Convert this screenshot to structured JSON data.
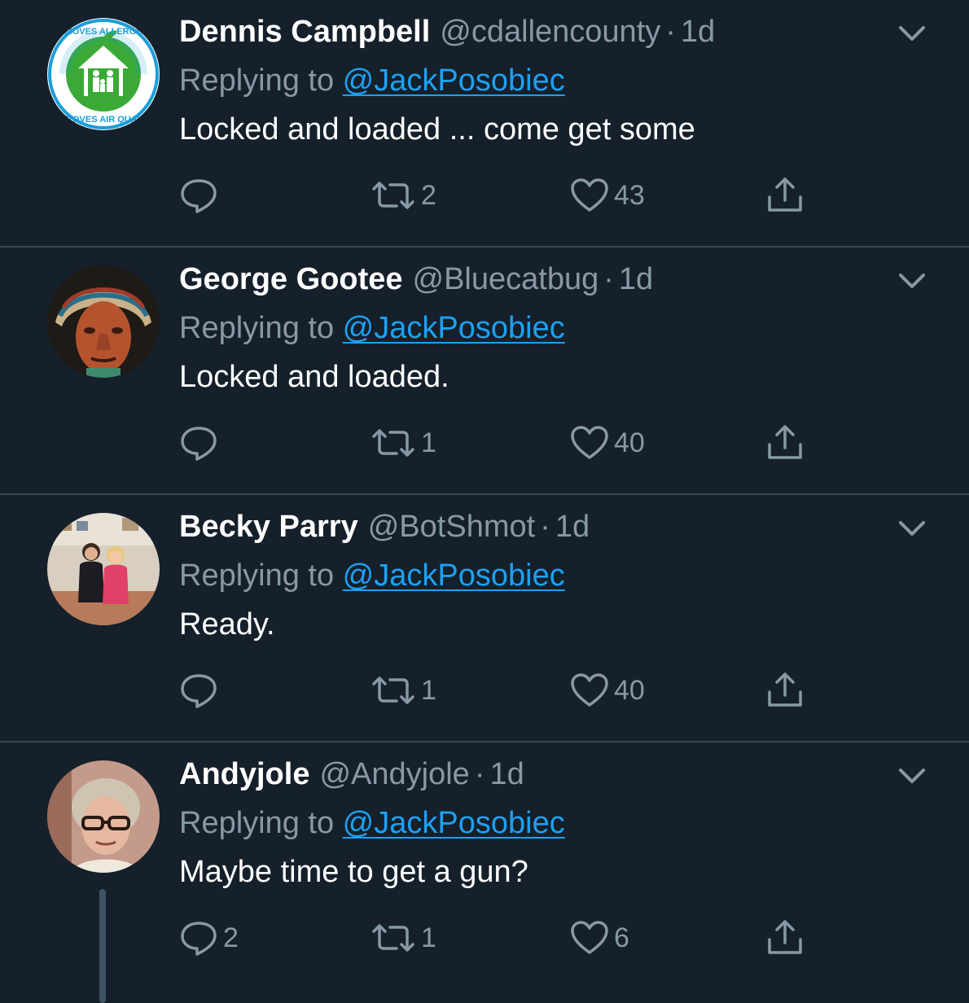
{
  "tweets": [
    {
      "name": "Dennis Campbell",
      "handle": "@cdallencounty",
      "separator": "·",
      "time": "1d",
      "replying_prefix": "Replying to ",
      "replying_to": "@JackPosobiec",
      "text": "Locked and loaded ... come get some",
      "replies": "",
      "retweets": "2",
      "likes": "43",
      "avatar": {
        "type": "logo",
        "ring_text_top": "REMOVES ALLERGENS",
        "ring_text_bottom": "IMPROVES AIR QUALITY",
        "colors": {
          "ring": "#1a9ed9",
          "center": "#3aa936"
        }
      }
    },
    {
      "name": "George Gootee",
      "handle": "@Bluecatbug",
      "separator": "·",
      "time": "1d",
      "replying_prefix": "Replying to ",
      "replying_to": "@JackPosobiec",
      "text": "Locked and loaded.",
      "replies": "",
      "retweets": "1",
      "likes": "40",
      "avatar": {
        "type": "photo",
        "subject": "carved wooden headdress statue"
      }
    },
    {
      "name": "Becky Parry",
      "handle": "@BotShmot",
      "separator": "·",
      "time": "1d",
      "replying_prefix": "Replying to ",
      "replying_to": "@JackPosobiec",
      "text": "Ready.",
      "replies": "",
      "retweets": "1",
      "likes": "40",
      "avatar": {
        "type": "photo",
        "subject": "two women in a room"
      }
    },
    {
      "name": "Andyjole",
      "handle": "@Andyjole",
      "separator": "·",
      "time": "1d",
      "replying_prefix": "Replying to ",
      "replying_to": "@JackPosobiec",
      "text": "Maybe time to get a gun?",
      "replies": "2",
      "retweets": "1",
      "likes": "6",
      "avatar": {
        "type": "photo",
        "subject": "woman with glasses"
      }
    }
  ],
  "icons": {
    "reply": "reply-icon",
    "retweet": "retweet-icon",
    "like": "heart-icon",
    "share": "share-icon",
    "menu": "chevron-down-icon"
  },
  "colors": {
    "background": "#15202b",
    "divider": "#38444d",
    "secondary_text": "#8899a6",
    "link": "#1da1f2"
  }
}
